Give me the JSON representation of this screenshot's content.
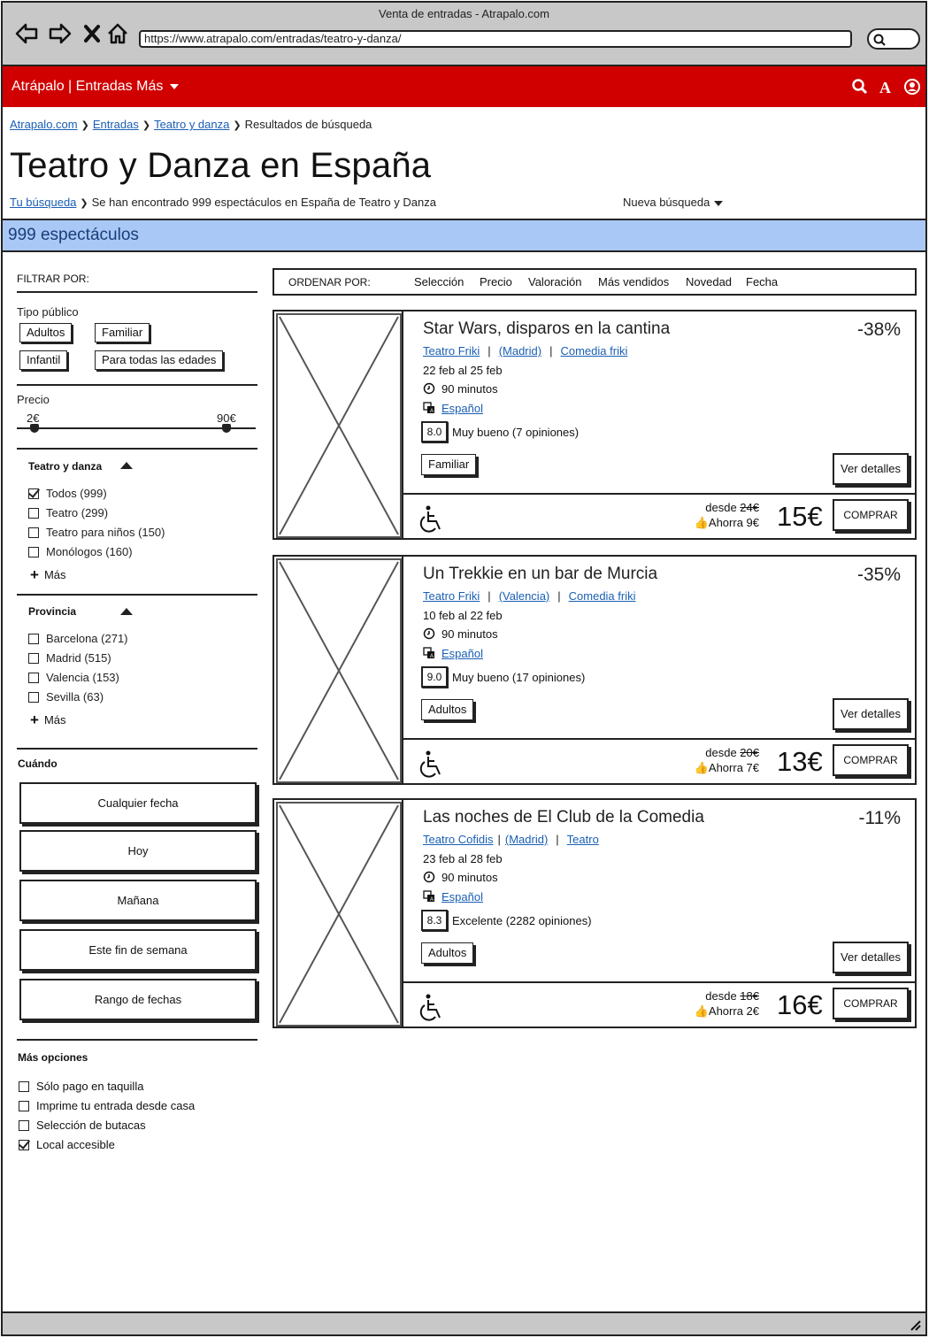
{
  "window": {
    "title": "Venta de entradas - Atrapalo.com"
  },
  "browser": {
    "url": "https://www.atrapalo.com/entradas/teatro-y-danza/"
  },
  "header": {
    "brand": "Atrápalo | Entradas Más",
    "bg_color": "#d00000"
  },
  "breadcrumb": [
    {
      "label": "Atrapalo.com",
      "link": true
    },
    {
      "label": "Entradas",
      "link": true
    },
    {
      "label": "Teatro y danza",
      "link": true
    },
    {
      "label": "Resultados de búsqueda",
      "link": false
    }
  ],
  "page": {
    "title": "Teatro y Danza en España",
    "search_link": "Tu búsqueda",
    "search_summary": "Se han encontrado 999 espectáculos en España de Teatro y Danza",
    "new_search": "Nueva búsqueda",
    "count_label": "999 espectáculos"
  },
  "filters": {
    "heading": "FILTRAR POR:",
    "public_label": "Tipo público",
    "public_chips": [
      "Adultos",
      "Familiar",
      "Infantil",
      "Para todas las edades"
    ],
    "price_label": "Precio",
    "price_min": "2€",
    "price_max": "90€",
    "category": {
      "heading": "Teatro y danza",
      "items": [
        {
          "label": "Todos (999)",
          "checked": true
        },
        {
          "label": "Teatro (299)",
          "checked": false
        },
        {
          "label": "Teatro para niños (150)",
          "checked": false
        },
        {
          "label": "Monólogos (160)",
          "checked": false
        }
      ],
      "more": "Más"
    },
    "province": {
      "heading": "Provincia",
      "items": [
        {
          "label": "Barcelona (271)",
          "checked": false
        },
        {
          "label": "Madrid (515)",
          "checked": false
        },
        {
          "label": "Valencia (153)",
          "checked": false
        },
        {
          "label": "Sevilla (63)",
          "checked": false
        }
      ],
      "more": "Más"
    },
    "when": {
      "heading": "Cuándo",
      "buttons": [
        "Cualquier fecha",
        "Hoy",
        "Mañana",
        "Este fin de semana",
        "Rango de fechas"
      ]
    },
    "more_options": {
      "heading": "Más opciones",
      "items": [
        {
          "label": "Sólo pago en taquilla",
          "checked": false
        },
        {
          "label": "Imprime tu entrada desde casa",
          "checked": false
        },
        {
          "label": "Selección de butacas",
          "checked": false
        },
        {
          "label": "Local accesible",
          "checked": true
        }
      ]
    }
  },
  "sort": {
    "label": "ORDENAR POR:",
    "options": [
      "Selección",
      "Precio",
      "Valoración",
      "Más vendidos",
      "Novedad",
      "Fecha"
    ]
  },
  "results": [
    {
      "title": "Star Wars, disparos en la cantina",
      "discount": "-38%",
      "venue": "Teatro Friki",
      "city": "(Madrid)",
      "genre": "Comedia friki",
      "dates": "22 feb al 25 feb",
      "duration": "90 minutos",
      "language": "Español",
      "score": "8.0",
      "score_text": "Muy bueno (7 opiniones)",
      "audience": "Familiar",
      "details_label": "Ver detalles",
      "desde_label": "desde",
      "old_price": "24€",
      "saving": "Ahorra 9€",
      "price": "15€",
      "buy_label": "COMPRAR"
    },
    {
      "title": "Un Trekkie en un bar de Murcia",
      "discount": "-35%",
      "venue": "Teatro Friki",
      "city": "(Valencia)",
      "genre": "Comedia friki",
      "dates": "10 feb al 22 feb",
      "duration": "90 minutos",
      "language": "Español",
      "score": "9.0",
      "score_text": "Muy bueno (17 opiniones)",
      "audience": "Adultos",
      "details_label": "Ver detalles",
      "desde_label": "desde",
      "old_price": "20€",
      "saving": "Ahorra 7€",
      "price": "13€",
      "buy_label": "COMPRAR"
    },
    {
      "title": "Las noches de El Club de la Comedia",
      "discount": "-11%",
      "venue": "Teatro Cofidis",
      "city": "(Madrid)",
      "genre": "Teatro",
      "dates": "23 feb al 28 feb",
      "duration": "90 minutos",
      "language": "Español",
      "score": "8.3",
      "score_text": "Excelente (2282 opiniones)",
      "audience": "Adultos",
      "details_label": "Ver detalles",
      "desde_label": "desde",
      "old_price": "18€",
      "saving": "Ahorra 2€",
      "price": "16€",
      "buy_label": "COMPRAR"
    }
  ]
}
